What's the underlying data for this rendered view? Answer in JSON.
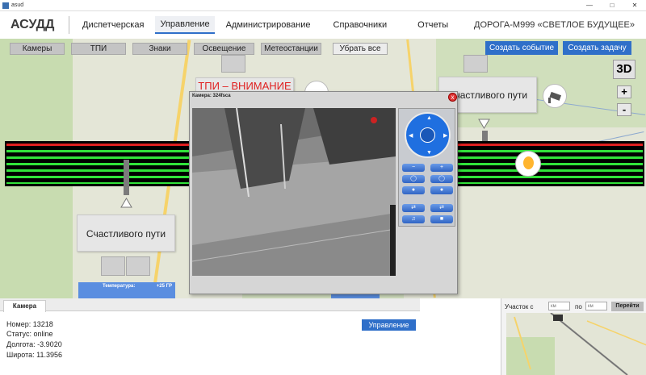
{
  "window": {
    "title": "asud"
  },
  "nav": {
    "brand": "АСУДД",
    "tabs": [
      "Диспетчерская",
      "Управление",
      "Администрирование",
      "Справочники",
      "Отчеты"
    ],
    "active_tab": "Управление",
    "road": "ДОРОГА-М999  «СВЕТЛОЕ БУДУЩЕЕ»"
  },
  "layers": {
    "cameras": "Камеры",
    "tpi": "ТПИ",
    "signs": "Знаки",
    "lighting": "Освещение",
    "weather": "Метеостанции",
    "clear": "Убрать все"
  },
  "actions": {
    "create_event": "Создать событие",
    "create_task": "Создать задачу"
  },
  "map": {
    "btn_3d": "3D",
    "zoom_in": "+",
    "zoom_out": "-",
    "sign_tpi": "ТПИ – ВНИМАНИЕ",
    "sign_right": "Счастливого пути",
    "sign_left": "Счастливого пути",
    "weather_temp_label": "Температура:",
    "weather_temp_value": "+25 ГР"
  },
  "camera_dialog": {
    "title": "Камера: 324fsca",
    "close": "x"
  },
  "bottom": {
    "tab": "Камера",
    "number": "Номер: 13218",
    "status": "Статус: online",
    "longitude": "Долгота: -3.9020",
    "latitude": "Широта: 11.3956",
    "manage": "Управление"
  },
  "section": {
    "from_label": "Участок с",
    "from_placeholder": "км",
    "to_label": "по",
    "to_placeholder": "км",
    "go": "Перейти"
  },
  "colors": {
    "accent": "#2f6fc9",
    "red_lane": "#e01f1f",
    "green_lane": "#31e23a",
    "weather_blue": "#5a8ee0"
  }
}
